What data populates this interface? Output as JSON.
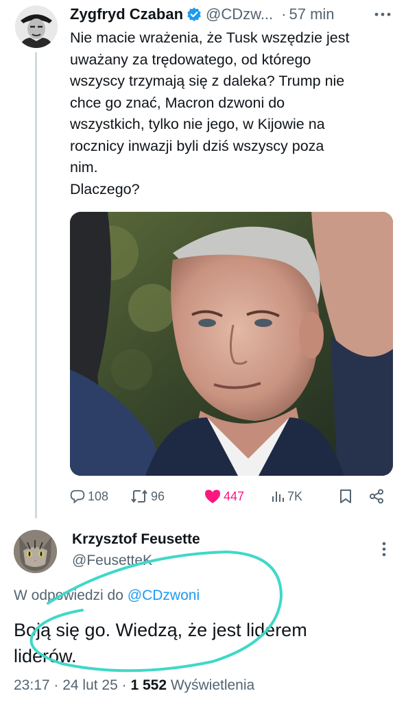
{
  "tweet": {
    "author_name": "Zygfryd Czaban",
    "handle": "@CDzw...",
    "separator": "·",
    "time": "57 min",
    "text_lines": [
      "Nie macie wrażenia, że Tusk wszędzie jest",
      "uważany za trędowatego, od którego",
      "wszyscy trzymają się z daleka? Trump nie",
      "chce go znać, Macron dzwoni do",
      "wszystkich, tylko nie jego, w Kijowie na",
      "rocznicy inwazji byli dziś wszyscy poza",
      "nim.",
      "Dlaczego?"
    ],
    "actions": {
      "replies": "108",
      "reposts": "96",
      "likes": "447",
      "views": "7K"
    },
    "colors": {
      "verified": "#1d9bf0",
      "like": "#f91880",
      "muted": "#536471"
    }
  },
  "reply": {
    "author_name": "Krzysztof Feusette",
    "handle": "@FeusetteK",
    "in_reply_prefix": "W odpowiedzi do",
    "in_reply_handle": "@CDzwoni",
    "text_lines": [
      "Boją się go. Wiedzą, że jest liderem",
      "liderów."
    ],
    "meta_time": "23:17 · 24 lut 25 ·",
    "meta_views": "1 552",
    "meta_views_label": "Wyświetlenia",
    "colors": {
      "link": "#1d9bf0",
      "annotation": "#3fd8c8"
    }
  }
}
